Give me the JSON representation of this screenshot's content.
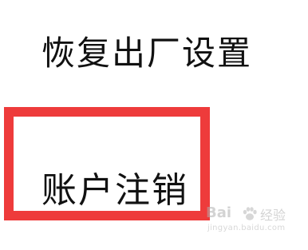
{
  "menu": {
    "items": [
      {
        "label": "恢复出厂设置"
      },
      {
        "label": "账户注销"
      }
    ]
  },
  "highlight": {
    "color": "#ee3b3b"
  },
  "watermark": {
    "brand": "Bai",
    "suffix": "经验",
    "url": "jingyan.baidu.com"
  }
}
